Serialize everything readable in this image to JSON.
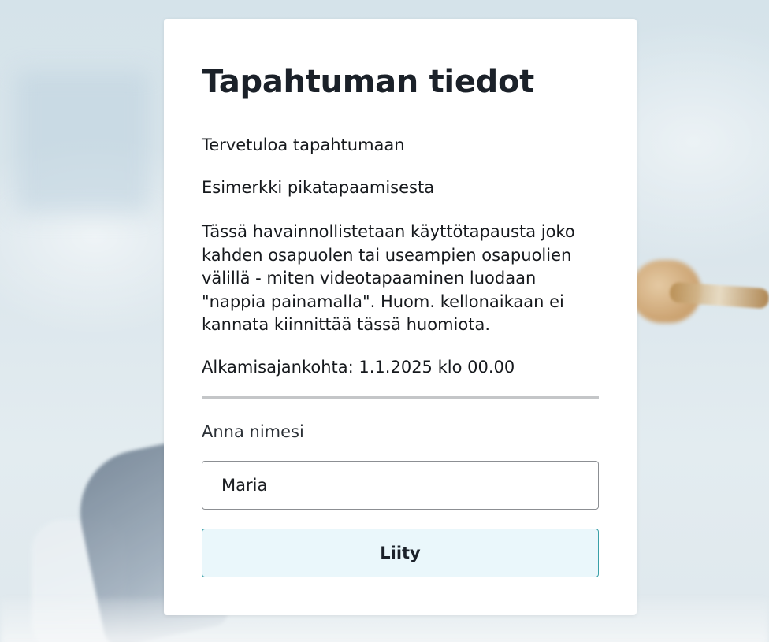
{
  "event": {
    "title": "Tapahtuman tiedot",
    "welcome": "Tervetuloa tapahtumaan",
    "event_name": "Esimerkki pikatapaamisesta",
    "description": "Tässä havainnollistetaan käyttötapausta joko kahden osapuolen tai useampien osapuolien välillä - miten videotapaaminen luodaan \"nappia painamalla\". Huom. kellonaikaan ei kannata kiinnittää tässä huomiota.",
    "start_time": "Alkamisajankohta: 1.1.2025 klo 00.00"
  },
  "form": {
    "name_label": "Anna nimesi",
    "name_value": "Maria",
    "join_label": "Liity"
  },
  "colors": {
    "accent_border": "#3aa0a8",
    "button_bg": "#eaf7fb",
    "text": "#1b2129"
  }
}
